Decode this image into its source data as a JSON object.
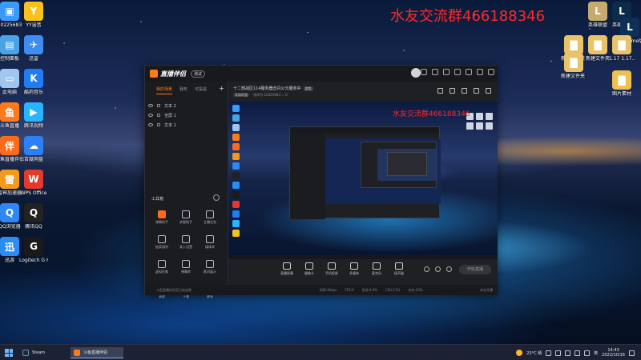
{
  "watermark": "水友交流群466188346",
  "watermark_inner": "水友交流群466188346",
  "desktop_left": [
    {
      "label": "10225683",
      "color": "#3a9bff",
      "glyph": "▣"
    },
    {
      "label": "YY语音",
      "color": "#f7c21c",
      "glyph": "Y"
    },
    {
      "label": "控制面板",
      "color": "#4aa3e6",
      "glyph": "▤"
    },
    {
      "label": "迅雷",
      "color": "#3d8ef0",
      "glyph": "✈"
    },
    {
      "label": "此电脑",
      "color": "#9fc7ef",
      "glyph": "▭"
    },
    {
      "label": "酷狗音乐",
      "color": "#1f7cf2",
      "glyph": "K"
    },
    {
      "label": "斗鱼直播",
      "color": "#ff7a1a",
      "glyph": "鱼"
    },
    {
      "label": "腾讯视频",
      "color": "#28b4ff",
      "glyph": "▶"
    },
    {
      "label": "斗鱼直播伴侣",
      "color": "#ff6a1a",
      "glyph": "伴"
    },
    {
      "label": "百度网盘",
      "color": "#2d7ff5",
      "glyph": "☁"
    },
    {
      "label": "雷神加速器",
      "color": "#f39a1c",
      "glyph": "雷"
    },
    {
      "label": "WPS Office",
      "color": "#e23b2e",
      "glyph": "W"
    },
    {
      "label": "QQ浏览器",
      "color": "#2e87f2",
      "glyph": "Q"
    },
    {
      "label": "腾讯QQ",
      "color": "#222222",
      "glyph": "Q"
    },
    {
      "label": "迅游",
      "color": "#2a8cf5",
      "glyph": "迅"
    },
    {
      "label": "Logitech G HUB",
      "color": "#1a1a1a",
      "glyph": "G"
    }
  ],
  "desktop_right": [
    {
      "label": "英雄联盟",
      "color": "#c8aa6e",
      "glyph": "L"
    },
    {
      "label": "英雄联盟",
      "color": "#0a2b4a",
      "glyph": "L"
    },
    {
      "label": "WeGame版",
      "color": "#0d3054",
      "glyph": "L"
    },
    {
      "label": "新建文件夹 (2)",
      "color": "#e8c36a",
      "glyph": "▇"
    },
    {
      "label": "新建文件夹",
      "color": "#e8c36a",
      "glyph": "▇"
    },
    {
      "label": "1.17 1.17...",
      "color": "#e8c36a",
      "glyph": "▇"
    },
    {
      "label": "新建文件夹 (3)",
      "color": "#e8c36a",
      "glyph": "▇"
    },
    {
      "label": "图片素材",
      "color": "#f0c050",
      "glyph": "▇"
    }
  ],
  "app": {
    "logo": "直播伴侣",
    "version": "测试",
    "left_tabs": [
      "我的场景",
      "我布",
      "可是是"
    ],
    "add_label": "+",
    "scenes": [
      "文本 2",
      "全屏 1",
      "文本 1"
    ],
    "tools_title": "工具箱",
    "tools": [
      {
        "label": "弹幕助手",
        "accent": true
      },
      {
        "label": "房管助手",
        "accent": false
      },
      {
        "label": "主播任务",
        "accent": false
      },
      {
        "label": "抽奖福利",
        "accent": false
      },
      {
        "label": "录入设置",
        "accent": false
      },
      {
        "label": "媒体库",
        "accent": false
      },
      {
        "label": "虚拟形象",
        "accent": false
      },
      {
        "label": "弹幕库",
        "accent": false
      },
      {
        "label": "歌词展示",
        "accent": false
      },
      {
        "label": "录屏",
        "accent": false
      },
      {
        "label": "下载",
        "accent": false
      },
      {
        "label": "更多",
        "accent": false
      }
    ],
    "room_title": "十二部战区114服务器击丹公元服务中",
    "room_badge": "游戏",
    "room_sub_pill": "英雄联盟",
    "room_id": "房间号:10225683",
    "hot": "0",
    "bottom_buttons": [
      "直播屏幕",
      "摄像头",
      "手机投屏",
      "多媒体",
      "麦克风",
      "扬声器"
    ],
    "go_live": "开始直播",
    "status_left": "斗鱼直播伴侣官方粉丝群",
    "status_stats": [
      "码率:0kbps",
      "FPS:0",
      "丢帧:0.0%",
      "CPU:11%",
      "内存:23%"
    ],
    "status_right": "本次开播"
  },
  "taskbar": {
    "items": [
      "Steam",
      "斗鱼直播伴侣"
    ],
    "weather": "23°C 晴",
    "lang": "英",
    "time": "14:43",
    "date": "2022/10/16"
  }
}
